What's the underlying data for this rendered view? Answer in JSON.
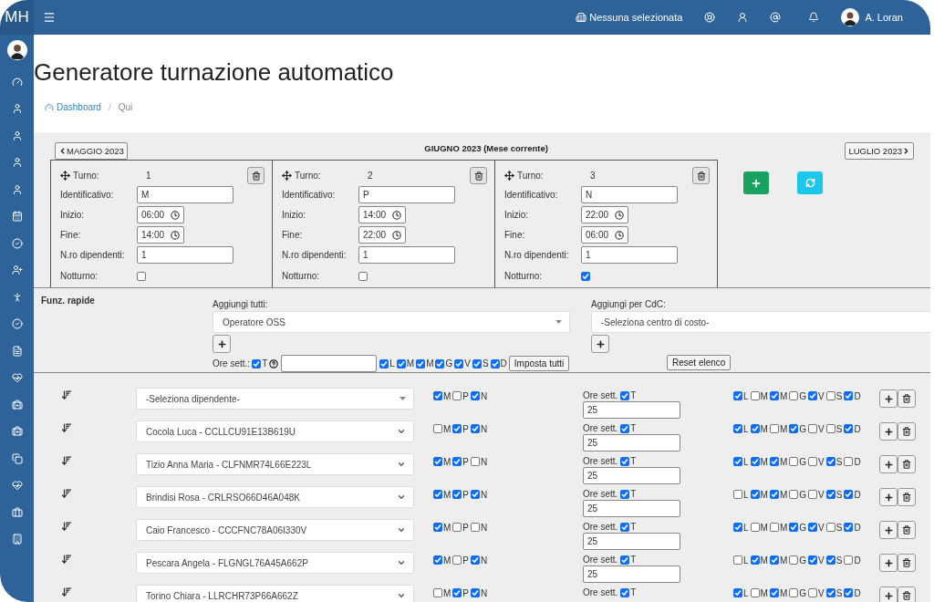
{
  "topbar": {
    "logo": "M**H**",
    "company": "Nessuna selezionata",
    "user": "A. Loran"
  },
  "page": {
    "title": "Generatore turnazione automatico",
    "breadcrumb_separator": "/",
    "breadcrumb": [
      {
        "label": "Dashboard",
        "link": true
      },
      {
        "label": "Qui",
        "link": false
      }
    ]
  },
  "months": {
    "previous": "MAGGIO 2023",
    "current": "GIUGNO 2023 (Mese corrente)",
    "next": "LUGLIO 2023"
  },
  "shifts": [
    {
      "turno_label": "Turno:",
      "number": "1",
      "fields": [
        {
          "kind": "text",
          "label": "Identificativo:",
          "value": "M"
        },
        {
          "kind": "time",
          "label": "Inizio:",
          "value": "06:00"
        },
        {
          "kind": "time",
          "label": "Fine:",
          "value": "14:00"
        },
        {
          "kind": "text",
          "label": "N.ro dipendenti:",
          "value": "1"
        }
      ],
      "night_label": "Notturno:",
      "night": false
    },
    {
      "turno_label": "Turno:",
      "number": "2",
      "fields": [
        {
          "kind": "text",
          "label": "Identificativo:",
          "value": "P"
        },
        {
          "kind": "time",
          "label": "Inizio:",
          "value": "14:00"
        },
        {
          "kind": "time",
          "label": "Fine:",
          "value": "22:00"
        },
        {
          "kind": "text",
          "label": "N.ro dipendenti:",
          "value": "1"
        }
      ],
      "night_label": "Notturno:",
      "night": false
    },
    {
      "turno_label": "Turno:",
      "number": "3",
      "fields": [
        {
          "kind": "text",
          "label": "Identificativo:",
          "value": "N"
        },
        {
          "kind": "time",
          "label": "Inizio:",
          "value": "22:00"
        },
        {
          "kind": "time",
          "label": "Fine:",
          "value": "06:00"
        },
        {
          "kind": "text",
          "label": "N.ro dipendenti:",
          "value": "1"
        }
      ],
      "night_label": "Notturno:",
      "night": true
    }
  ],
  "quick": {
    "title": "Funz. rapide",
    "add_all_label": "Aggiungi tutti:",
    "add_all_value": "Operatore OSS",
    "cdc_label": "Aggiungi per CdC:",
    "cdc_value": "-Seleziona centro di costo-",
    "hours_label": "Ore sett.:",
    "total": {
      "label": "T",
      "checked": true
    },
    "days": [
      {
        "label": "L",
        "checked": true
      },
      {
        "label": "M",
        "checked": true
      },
      {
        "label": "M",
        "checked": true
      },
      {
        "label": "G",
        "checked": true
      },
      {
        "label": "V",
        "checked": true
      },
      {
        "label": "S",
        "checked": true
      },
      {
        "label": "D",
        "checked": true
      }
    ],
    "apply_button": "Imposta tutti",
    "reset_button": "Reset elenco"
  },
  "rows": [
    {
      "placeholder": "-Seleziona dipendente-",
      "shifts": [
        {
          "label": "M",
          "checked": true
        },
        {
          "label": "P",
          "checked": false
        },
        {
          "label": "N",
          "checked": true
        }
      ],
      "hours_label": "Ore sett.",
      "total": {
        "label": "T",
        "checked": true
      },
      "hours": "25",
      "days": [
        {
          "label": "L",
          "checked": true
        },
        {
          "label": "M",
          "checked": false
        },
        {
          "label": "M",
          "checked": true
        },
        {
          "label": "G",
          "checked": false
        },
        {
          "label": "V",
          "checked": true
        },
        {
          "label": "S",
          "checked": false
        },
        {
          "label": "D",
          "checked": true
        }
      ]
    },
    {
      "value": "Cocola Luca - CCLLCU91E13B619U",
      "shifts": [
        {
          "label": "M",
          "checked": false
        },
        {
          "label": "P",
          "checked": true
        },
        {
          "label": "N",
          "checked": true
        }
      ],
      "hours_label": "Ore sett.",
      "total": {
        "label": "T",
        "checked": true
      },
      "hours": "25",
      "days": [
        {
          "label": "L",
          "checked": true
        },
        {
          "label": "M",
          "checked": true
        },
        {
          "label": "M",
          "checked": false
        },
        {
          "label": "G",
          "checked": true
        },
        {
          "label": "V",
          "checked": false
        },
        {
          "label": "S",
          "checked": false
        },
        {
          "label": "D",
          "checked": true
        }
      ]
    },
    {
      "value": "Tizio Anna Maria - CLFNMR74L66E223L",
      "shifts": [
        {
          "label": "M",
          "checked": true
        },
        {
          "label": "P",
          "checked": true
        },
        {
          "label": "N",
          "checked": false
        }
      ],
      "hours_label": "Ore sett.",
      "total": {
        "label": "T",
        "checked": true
      },
      "hours": "25",
      "days": [
        {
          "label": "L",
          "checked": true
        },
        {
          "label": "M",
          "checked": true
        },
        {
          "label": "M",
          "checked": true
        },
        {
          "label": "G",
          "checked": false
        },
        {
          "label": "V",
          "checked": false
        },
        {
          "label": "S",
          "checked": true
        },
        {
          "label": "D",
          "checked": false
        }
      ]
    },
    {
      "value": "Brindisi Rosa - CRLRSO66D46A048K",
      "shifts": [
        {
          "label": "M",
          "checked": true
        },
        {
          "label": "P",
          "checked": true
        },
        {
          "label": "N",
          "checked": true
        }
      ],
      "hours_label": "Ore sett.",
      "total": {
        "label": "T",
        "checked": true
      },
      "hours": "25",
      "days": [
        {
          "label": "L",
          "checked": false
        },
        {
          "label": "M",
          "checked": true
        },
        {
          "label": "M",
          "checked": true
        },
        {
          "label": "G",
          "checked": false
        },
        {
          "label": "V",
          "checked": false
        },
        {
          "label": "S",
          "checked": true
        },
        {
          "label": "D",
          "checked": true
        }
      ]
    },
    {
      "value": "Caio Francesco - CCCFNC78A06I330V",
      "shifts": [
        {
          "label": "M",
          "checked": true
        },
        {
          "label": "P",
          "checked": false
        },
        {
          "label": "N",
          "checked": false
        }
      ],
      "hours_label": "Ore sett.",
      "total": {
        "label": "T",
        "checked": true
      },
      "hours": "25",
      "days": [
        {
          "label": "L",
          "checked": true
        },
        {
          "label": "M",
          "checked": false
        },
        {
          "label": "M",
          "checked": false
        },
        {
          "label": "G",
          "checked": true
        },
        {
          "label": "V",
          "checked": true
        },
        {
          "label": "S",
          "checked": false
        },
        {
          "label": "D",
          "checked": true
        }
      ]
    },
    {
      "value": "Pescara Angela - FLGNGL76A45A662P",
      "shifts": [
        {
          "label": "M",
          "checked": true
        },
        {
          "label": "P",
          "checked": false
        },
        {
          "label": "N",
          "checked": true
        }
      ],
      "hours_label": "Ore sett.",
      "total": {
        "label": "T",
        "checked": true
      },
      "hours": "25",
      "days": [
        {
          "label": "L",
          "checked": false
        },
        {
          "label": "M",
          "checked": true
        },
        {
          "label": "M",
          "checked": true
        },
        {
          "label": "G",
          "checked": false
        },
        {
          "label": "V",
          "checked": true
        },
        {
          "label": "S",
          "checked": true
        },
        {
          "label": "D",
          "checked": false
        }
      ]
    },
    {
      "value": "Torino Chiara - LLRCHR73P66A662Z",
      "shifts": [
        {
          "label": "M",
          "checked": false
        },
        {
          "label": "P",
          "checked": true
        },
        {
          "label": "N",
          "checked": true
        }
      ],
      "hours_label": "Ore sett.",
      "total": {
        "label": "T",
        "checked": true
      },
      "days": [
        {
          "label": "L",
          "checked": true
        },
        {
          "label": "M",
          "checked": false
        },
        {
          "label": "M",
          "checked": true
        },
        {
          "label": "G",
          "checked": false
        },
        {
          "label": "V",
          "checked": false
        },
        {
          "label": "S",
          "checked": true
        },
        {
          "label": "D",
          "checked": true
        }
      ]
    }
  ]
}
